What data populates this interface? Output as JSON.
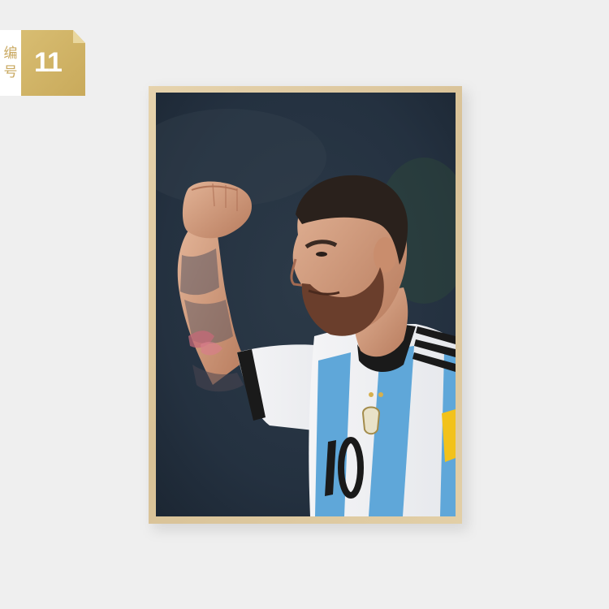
{
  "badge": {
    "label_line1": "编",
    "label_line2": "号",
    "number": "11",
    "color": "#cfb265"
  },
  "poster": {
    "frame_color": "#dcc59b",
    "photo_description_icon": "footballer-celebrating-photo"
  }
}
